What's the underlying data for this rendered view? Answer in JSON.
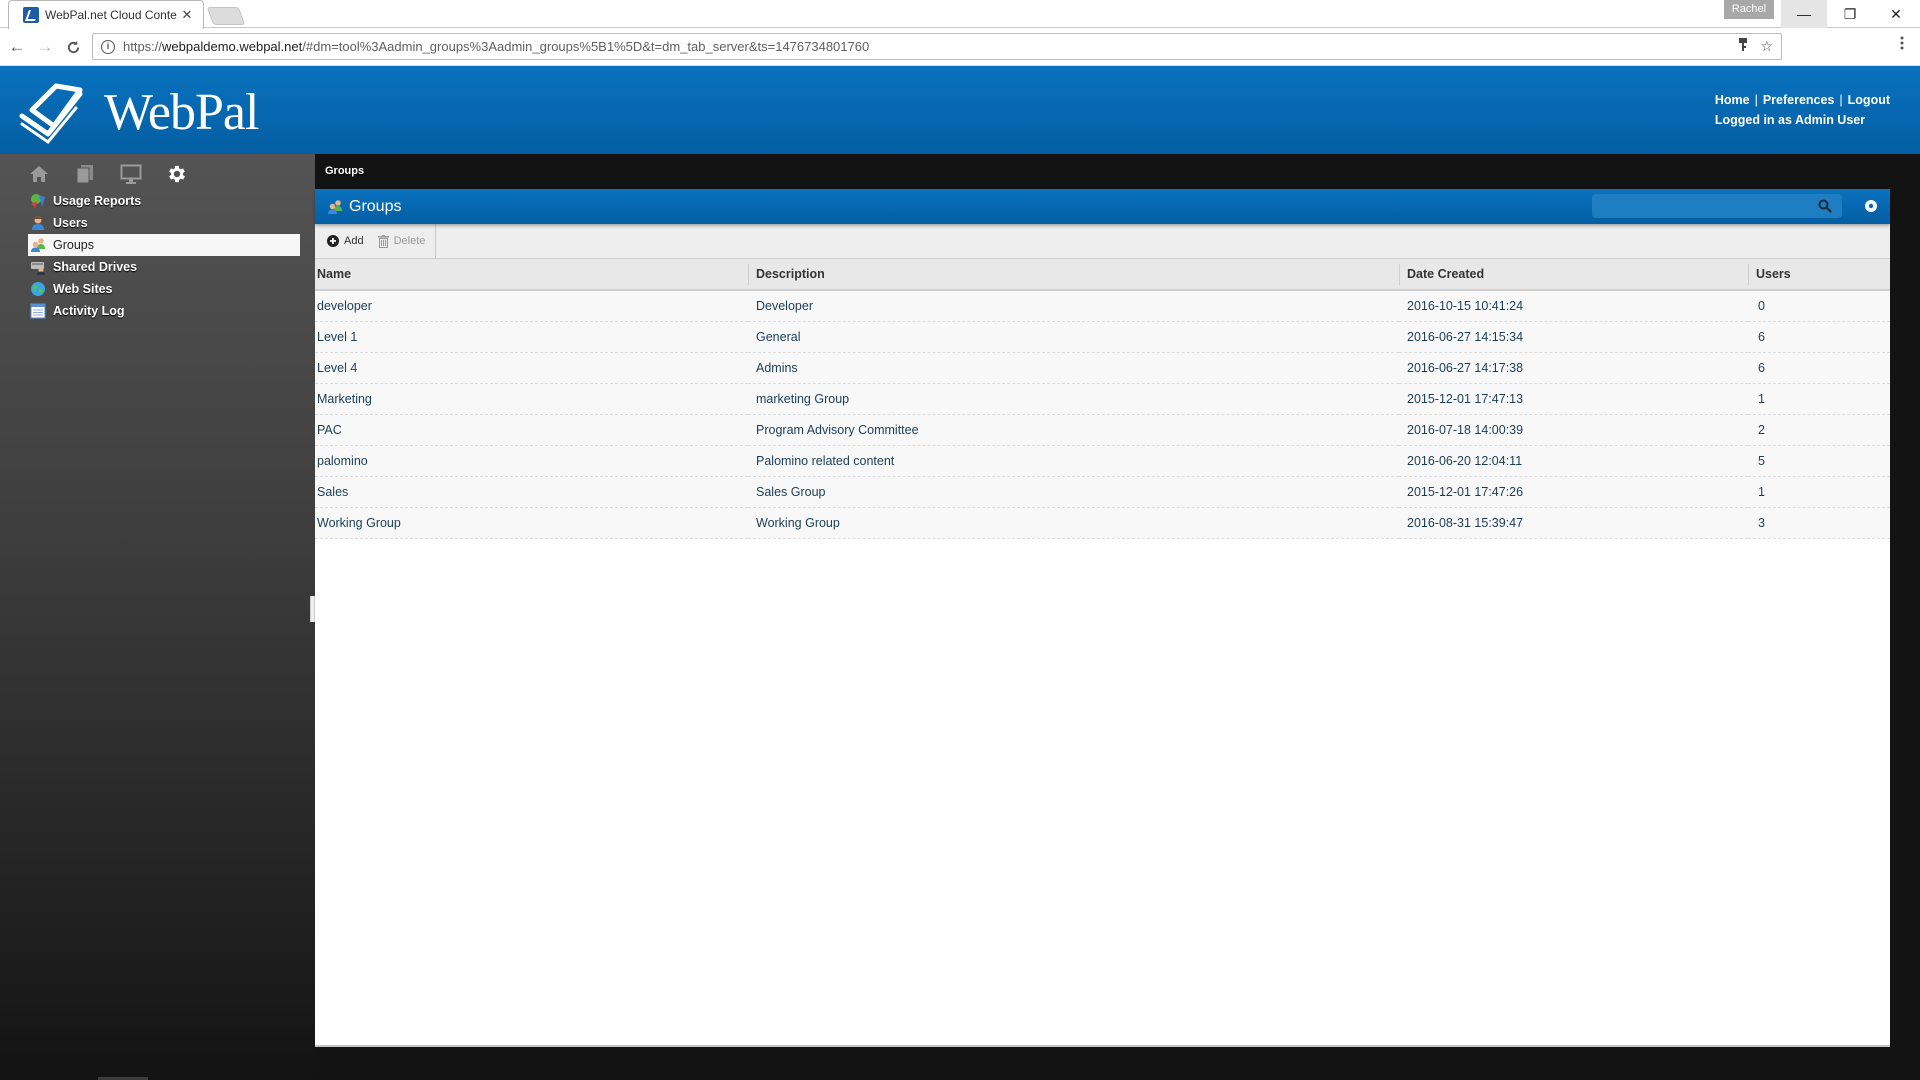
{
  "browser": {
    "tab_title": "WebPal.net Cloud Conte",
    "tab_close": "✕",
    "profile_name": "Rachel",
    "window_controls": {
      "minimize": "—",
      "restore": "❐",
      "close": "✕"
    },
    "nav": {
      "back": "←",
      "forward": "→",
      "reload": "C"
    },
    "url_scheme": "https://",
    "url_host": "webpaldemo.webpal.net",
    "url_rest": "/#dm=tool%3Aadmin_groups%3Aadmin_groups%5B1%5D&t=dm_tab_server&ts=1476734801760",
    "info_glyph": "i",
    "key_glyph": "⚲",
    "star_glyph": "☆",
    "menu_glyph": "⋮"
  },
  "header": {
    "logo_text": "WebPal",
    "links": {
      "home": "Home",
      "preferences": "Preferences",
      "logout": "Logout"
    },
    "separator": "|",
    "logged_in": "Logged in as Admin User"
  },
  "sidebar": {
    "tools": [
      "home-icon",
      "documents-icon",
      "monitor-icon",
      "gear-icon"
    ],
    "items": [
      {
        "label": "Usage Reports",
        "icon": "usage-reports-icon"
      },
      {
        "label": "Users",
        "icon": "user-icon"
      },
      {
        "label": "Groups",
        "icon": "groups-icon",
        "active": true
      },
      {
        "label": "Shared Drives",
        "icon": "shared-drives-icon"
      },
      {
        "label": "Web Sites",
        "icon": "globe-icon"
      },
      {
        "label": "Activity Log",
        "icon": "activity-log-icon"
      }
    ]
  },
  "main": {
    "breadcrumb": "Groups",
    "panel_title": "Groups",
    "search": {
      "value": "",
      "placeholder": ""
    },
    "toolbar": {
      "add_label": "Add",
      "delete_label": "Delete"
    },
    "table": {
      "columns": [
        "Name",
        "Description",
        "Date Created",
        "Users"
      ],
      "rows": [
        {
          "name": "developer",
          "description": "Developer",
          "date_created": "2016-10-15 10:41:24",
          "users": "0"
        },
        {
          "name": "Level 1",
          "description": "General",
          "date_created": "2016-06-27 14:15:34",
          "users": "6"
        },
        {
          "name": "Level 4",
          "description": "Admins",
          "date_created": "2016-06-27 14:17:38",
          "users": "6"
        },
        {
          "name": "Marketing",
          "description": "marketing Group",
          "date_created": "2015-12-01 17:47:13",
          "users": "1"
        },
        {
          "name": "PAC",
          "description": "Program Advisory Committee",
          "date_created": "2016-07-18 14:00:39",
          "users": "2"
        },
        {
          "name": "palomino",
          "description": "Palomino related content",
          "date_created": "2016-06-20 12:04:11",
          "users": "5"
        },
        {
          "name": "Sales",
          "description": "Sales Group",
          "date_created": "2015-12-01 17:47:26",
          "users": "1"
        },
        {
          "name": "Working Group",
          "description": "Working Group",
          "date_created": "2016-08-31 15:39:47",
          "users": "3"
        }
      ]
    }
  },
  "colors": {
    "brand_blue": "#0a72bf",
    "brand_blue_dark": "#045ea3",
    "sidebar_bg": "#545454",
    "row_text": "#1c3d5a"
  }
}
